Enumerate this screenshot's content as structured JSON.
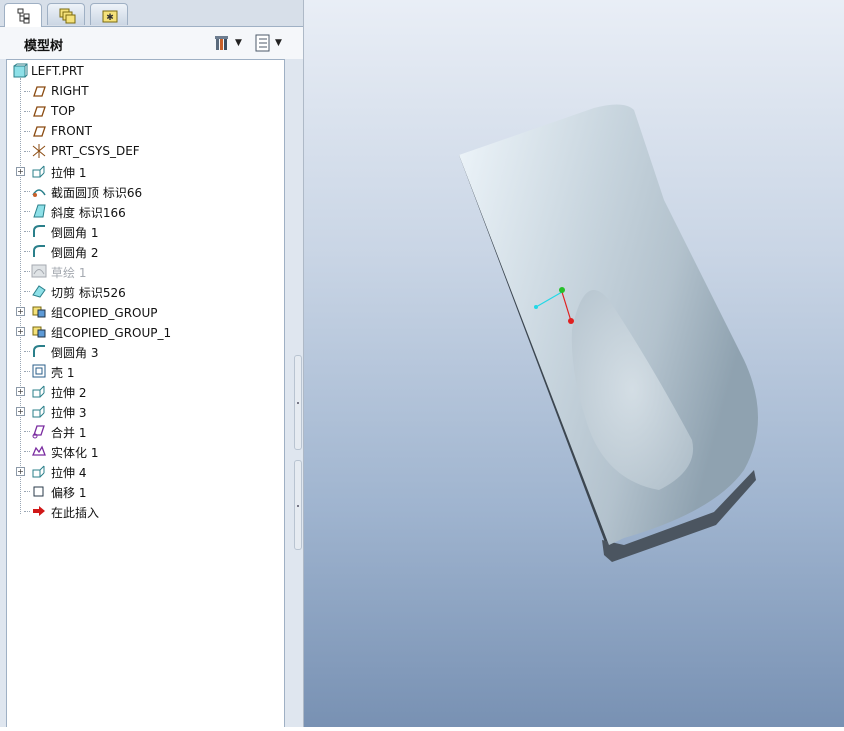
{
  "tabs": [
    {
      "name": "model-tree-tab",
      "icon": "model-tree-icon"
    },
    {
      "name": "layers-tab",
      "icon": "layers-icon"
    },
    {
      "name": "favorites-tab",
      "icon": "favorites-icon"
    }
  ],
  "tree": {
    "title": "模型树",
    "settings_icon": "tree-settings-icon",
    "columns_icon": "tree-columns-icon",
    "root": "LEFT.PRT",
    "items": [
      {
        "label": "RIGHT",
        "icon": "datum-plane-icon",
        "expand": false
      },
      {
        "label": "TOP",
        "icon": "datum-plane-icon",
        "expand": false
      },
      {
        "label": "FRONT",
        "icon": "datum-plane-icon",
        "expand": false
      },
      {
        "label": "PRT_CSYS_DEF",
        "icon": "csys-icon",
        "expand": false
      },
      {
        "label": "拉伸 1",
        "icon": "extrude-icon",
        "expand": true
      },
      {
        "label": "截面圆顶 标识66",
        "icon": "section-dome-icon",
        "expand": false
      },
      {
        "label": "斜度 标识166",
        "icon": "draft-icon",
        "expand": false
      },
      {
        "label": "倒圆角 1",
        "icon": "round-icon",
        "expand": false
      },
      {
        "label": "倒圆角 2",
        "icon": "round-icon",
        "expand": false
      },
      {
        "label": "草绘 1",
        "icon": "sketch-icon",
        "expand": false,
        "dim": true
      },
      {
        "label": "切剪 标识526",
        "icon": "cut-icon",
        "expand": false
      },
      {
        "label": "组COPIED_GROUP",
        "icon": "group-icon",
        "expand": true
      },
      {
        "label": "组COPIED_GROUP_1",
        "icon": "group-icon",
        "expand": true
      },
      {
        "label": "倒圆角 3",
        "icon": "round-icon",
        "expand": false
      },
      {
        "label": "壳 1",
        "icon": "shell-icon",
        "expand": false
      },
      {
        "label": "拉伸 2",
        "icon": "extrude-icon",
        "expand": true
      },
      {
        "label": "拉伸 3",
        "icon": "extrude-icon",
        "expand": true
      },
      {
        "label": "合并 1",
        "icon": "merge-icon",
        "expand": false
      },
      {
        "label": "实体化 1",
        "icon": "solidify-icon",
        "expand": false
      },
      {
        "label": "拉伸 4",
        "icon": "extrude-icon",
        "expand": true
      },
      {
        "label": "偏移 1",
        "icon": "offset-icon",
        "expand": false
      },
      {
        "label": "在此插入",
        "icon": "insert-here-arrow-icon",
        "expand": false
      }
    ]
  },
  "colors": {
    "viewport_top": "#e9eef6",
    "viewport_bottom": "#7891b3",
    "part_shade": "#c3d0da",
    "dim_text": "#a4a9b0"
  }
}
